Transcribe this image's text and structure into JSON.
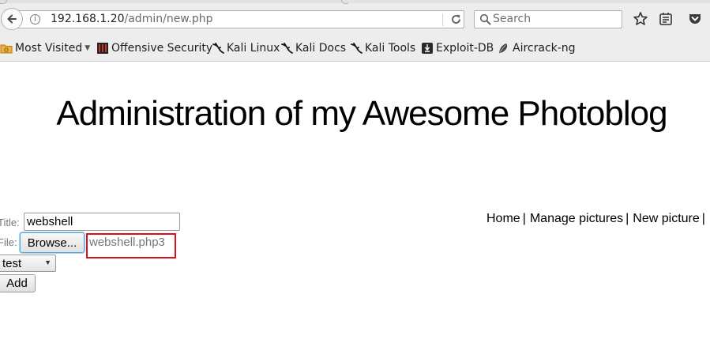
{
  "browser": {
    "url": {
      "host": "192.168.1.20",
      "path": "/admin/new.php"
    },
    "search": {
      "placeholder": "Search"
    },
    "bookmarks": [
      {
        "label": "Most Visited",
        "icon": "folder-icon",
        "has_dropdown": true
      },
      {
        "label": "Offensive Security",
        "icon": "offensive-security-icon"
      },
      {
        "label": "Kali Linux",
        "icon": "kali-dragon-icon"
      },
      {
        "label": "Kali Docs",
        "icon": "kali-dragon-icon"
      },
      {
        "label": "Kali Tools",
        "icon": "kali-dragon-icon"
      },
      {
        "label": "Exploit-DB",
        "icon": "exploit-db-icon"
      },
      {
        "label": "Aircrack-ng",
        "icon": "aircrack-icon"
      }
    ],
    "icons": {
      "back": "back-arrow-icon",
      "info": "info-icon",
      "reload": "reload-icon",
      "search": "search-icon",
      "bookmark_star": "star-icon",
      "reading_list": "reading-list-icon",
      "pocket": "pocket-icon"
    }
  },
  "page": {
    "heading": "Administration of my Awesome Photoblog",
    "nav": [
      {
        "label": "Home"
      },
      {
        "label": "Manage pictures"
      },
      {
        "label": "New picture"
      }
    ],
    "nav_separator": "|",
    "form": {
      "title_label": "Title:",
      "title_value": "webshell",
      "file_label": "File:",
      "browse_label": "Browse...",
      "file_name": "webshell.php3",
      "category_value": "test",
      "submit_label": "Add"
    }
  },
  "colors": {
    "highlight_box": "#d8111b",
    "browse_focus": "#53a6d6"
  }
}
